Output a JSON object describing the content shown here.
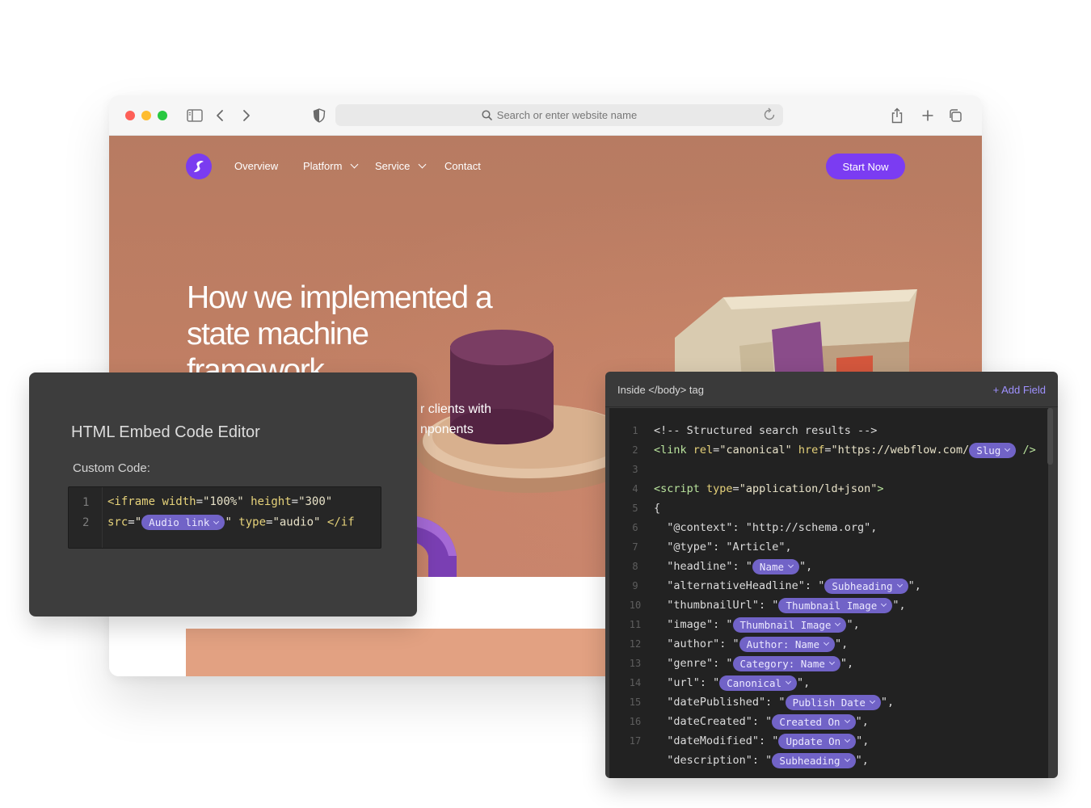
{
  "browser": {
    "url_placeholder": "Search or enter website name"
  },
  "site": {
    "nav": {
      "overview": "Overview",
      "platform": "Platform",
      "service": "Service",
      "contact": "Contact",
      "cta": "Start Now"
    },
    "hero_title_lines": [
      "How we implemented a",
      "state machine",
      "framework"
    ],
    "hero_subtitle_lines": [
      "r clients with",
      "nponents"
    ]
  },
  "embed_editor": {
    "title": "HTML Embed Code Editor",
    "label": "Custom Code:",
    "lines": [
      {
        "number": "1"
      },
      {
        "number": "2",
        "pill": "Audio link"
      }
    ]
  },
  "body_panel": {
    "title": "Inside </body> tag",
    "add_field": "+ Add Field",
    "line_numbers": [
      "1",
      "2",
      "3",
      "4",
      "5",
      "6",
      "7",
      "8",
      "9",
      "10",
      "11",
      "12",
      "13",
      "14",
      "15",
      "16",
      "17"
    ],
    "comment": "<!-- Structured search results -->",
    "link_href_prefix": "\"https://webflow.com/",
    "pills": {
      "slug": "Slug",
      "name": "Name",
      "subheading": "Subheading",
      "thumbnail_image": "Thumbnail Image",
      "author_name": "Author: Name",
      "category_name": "Category: Name",
      "canonical": "Canonical",
      "publish_date": "Publish Date",
      "created_on": "Created On",
      "update_on": "Update On"
    }
  },
  "colors": {
    "hero_background": "#bf7e63",
    "accent_purple": "#7b3cf2",
    "pill_purple": "#7163c7",
    "editor_background": "#3d3d3d",
    "code_background": "#222222"
  }
}
